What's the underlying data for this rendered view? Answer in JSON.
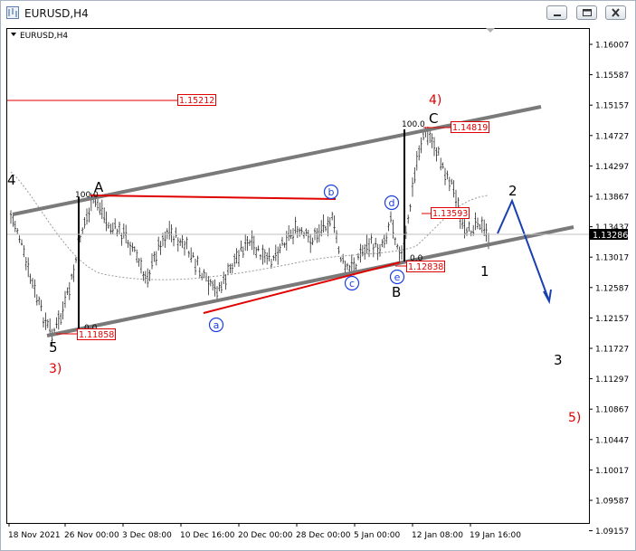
{
  "window": {
    "title": "EURUSD,H4"
  },
  "chart_data": {
    "type": "candlestick",
    "symbol_label": "EURUSD,H4",
    "current_price": "1.13286",
    "y_ticks": [
      "1.16007",
      "1.15587",
      "1.15157",
      "1.14727",
      "1.14297",
      "1.13867",
      "1.13437",
      "1.13017",
      "1.12587",
      "1.12157",
      "1.11727",
      "1.11297",
      "1.10867",
      "1.10447",
      "1.10017",
      "1.09587",
      "1.09157"
    ],
    "x_ticks": [
      "18 Nov 2021",
      "26 Nov 00:00",
      "3 Dec 08:00",
      "10 Dec 16:00",
      "20 Dec 00:00",
      "28 Dec 00:00",
      "5 Jan 00:00",
      "12 Jan 08:00",
      "19 Jan 16:00"
    ],
    "price_levels": [
      {
        "label": "1.15212",
        "price": 1.15212
      },
      {
        "label": "1.14819",
        "price": 1.14819
      },
      {
        "label": "1.13593",
        "price": 1.13593
      },
      {
        "label": "1.12838",
        "price": 1.12838
      },
      {
        "label": "1.11858",
        "price": 1.11858
      }
    ],
    "fib_labels": {
      "top_a": "100.0",
      "bottom_a": "0.0",
      "top_b": "100.0",
      "bottom_b": "0.0"
    },
    "wave_labels": {
      "w4_left": "4",
      "w5": "5",
      "w3_red": "3)",
      "wA": "A",
      "wB": "B",
      "wC": "C",
      "w4_red": "4)",
      "w1": "1",
      "w2": "2",
      "w3": "3",
      "w5_red": "5)",
      "circle_a": "a",
      "circle_b": "b",
      "circle_c": "c",
      "circle_d": "d",
      "circle_e": "e"
    }
  }
}
